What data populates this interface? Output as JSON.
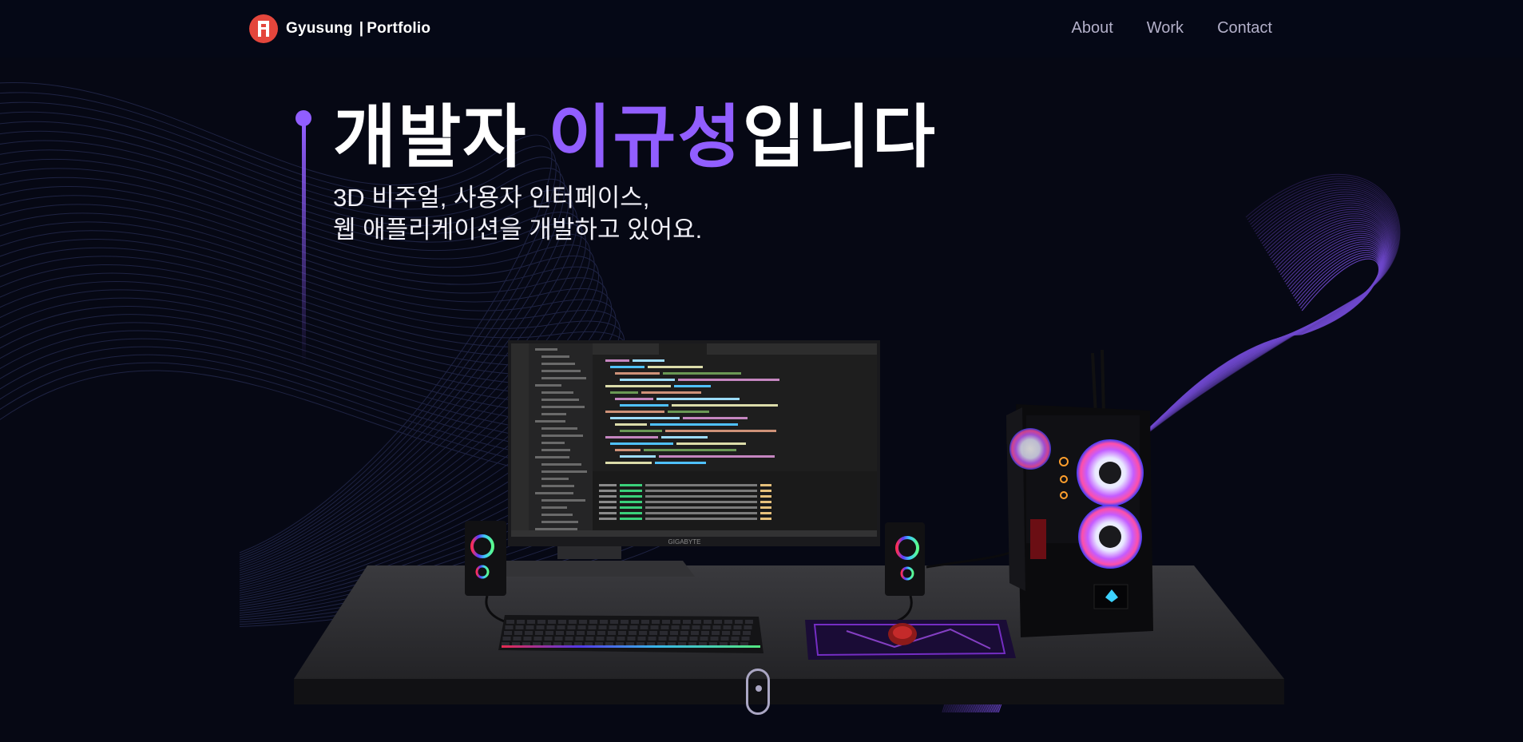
{
  "nav": {
    "brand_name": "Gyusung",
    "brand_separator": "|",
    "brand_suffix": "Portfolio",
    "links": [
      "About",
      "Work",
      "Contact"
    ]
  },
  "hero": {
    "title_prefix": "개발자 ",
    "title_accent": "이규성",
    "title_suffix": "입니다",
    "subtitle_line1": "3D 비주얼, 사용자 인터페이스,",
    "subtitle_line2": "웹 애플리케이션을 개발하고 있어요."
  },
  "scene": {
    "monitor_brand": "GIGABYTE"
  },
  "colors": {
    "background": "#060814",
    "accent": "#915eff",
    "logo": "#e4463c",
    "nav_link": "#b3b0c9"
  },
  "icons": [
    "logo-icon",
    "scroll-indicator-icon"
  ]
}
